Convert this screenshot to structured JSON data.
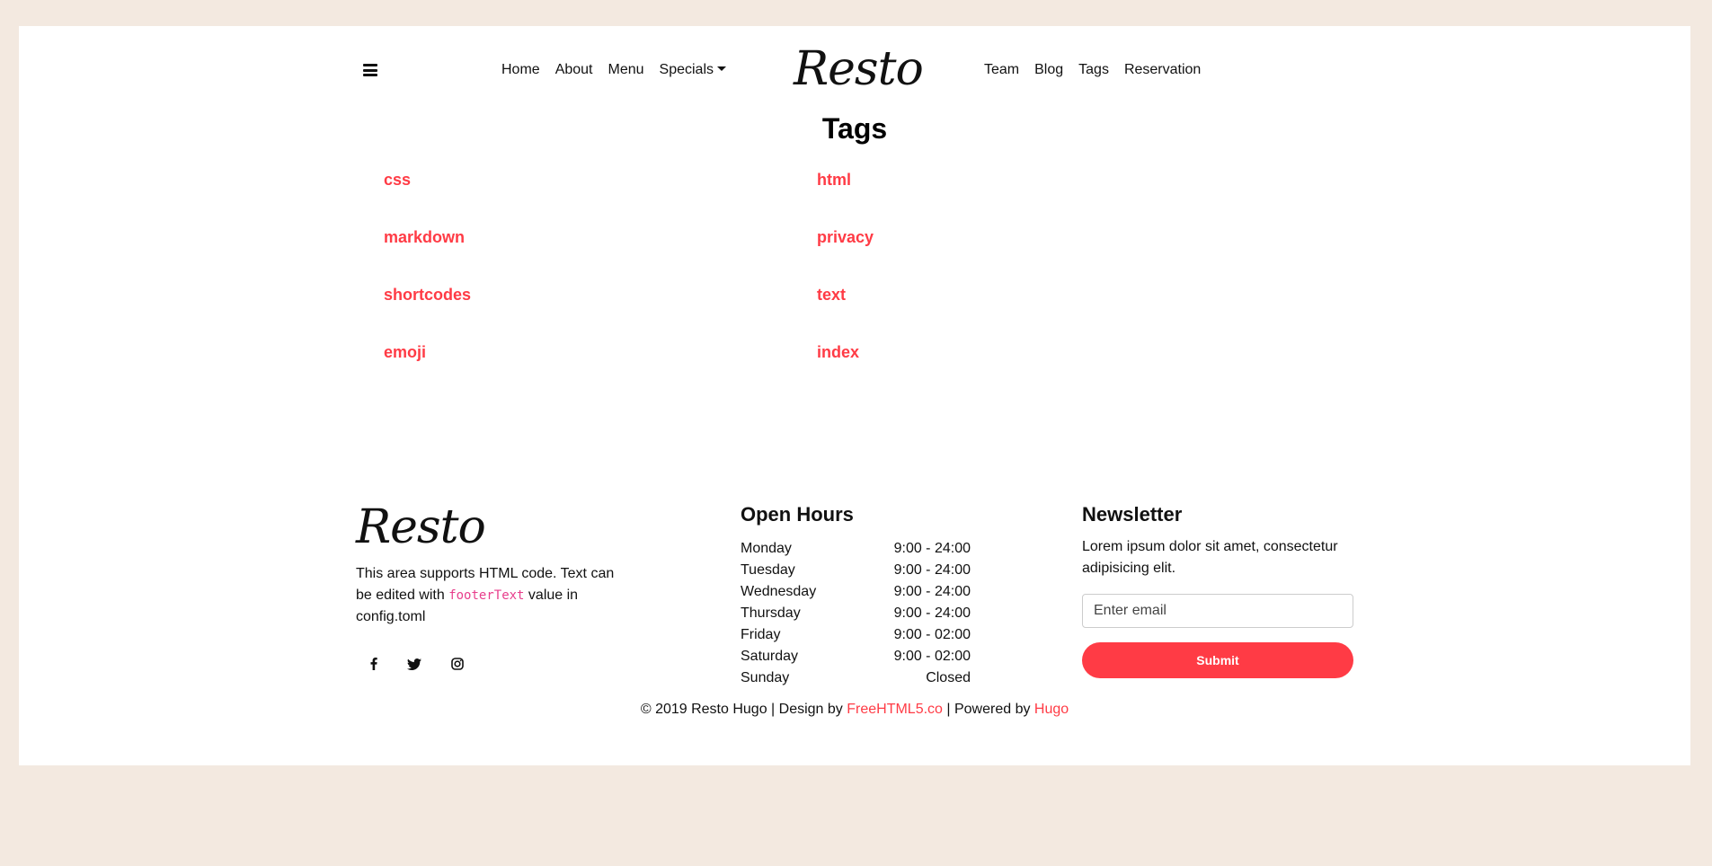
{
  "nav": {
    "left": [
      "Home",
      "About",
      "Menu",
      "Specials"
    ],
    "right": [
      "Team",
      "Blog",
      "Tags",
      "Reservation"
    ],
    "logo": "Resto"
  },
  "page": {
    "title": "Tags"
  },
  "tags": {
    "left": [
      "css",
      "markdown",
      "shortcodes",
      "emoji"
    ],
    "right": [
      "html",
      "privacy",
      "text",
      "index"
    ]
  },
  "footer": {
    "logo": "Resto",
    "text_before": "This area supports HTML code. Text can be edited with ",
    "code": "footerText",
    "text_after": " value in config.toml",
    "social": [
      "facebook-icon",
      "twitter-icon",
      "instagram-icon"
    ],
    "hours_title": "Open Hours",
    "hours": [
      {
        "day": "Monday",
        "time": "9:00 - 24:00"
      },
      {
        "day": "Tuesday",
        "time": "9:00 - 24:00"
      },
      {
        "day": "Wednesday",
        "time": "9:00 - 24:00"
      },
      {
        "day": "Thursday",
        "time": "9:00 - 24:00"
      },
      {
        "day": "Friday",
        "time": "9:00 - 02:00"
      },
      {
        "day": "Saturday",
        "time": "9:00 - 02:00"
      },
      {
        "day": "Sunday",
        "time": "Closed"
      }
    ],
    "newsletter_title": "Newsletter",
    "newsletter_text": "Lorem ipsum dolor sit amet, consectetur adipisicing elit.",
    "email_placeholder": "Enter email",
    "submit_label": "Submit",
    "copyright_prefix": "© 2019 Resto Hugo | Design by ",
    "design_link": "FreeHTML5.co",
    "copyright_mid": " | Powered by ",
    "powered_link": "Hugo"
  },
  "colors": {
    "accent": "#ff3b45",
    "page_bg": "#f3e9e0",
    "card_bg": "#ffffff",
    "code": "#e83e8c"
  }
}
